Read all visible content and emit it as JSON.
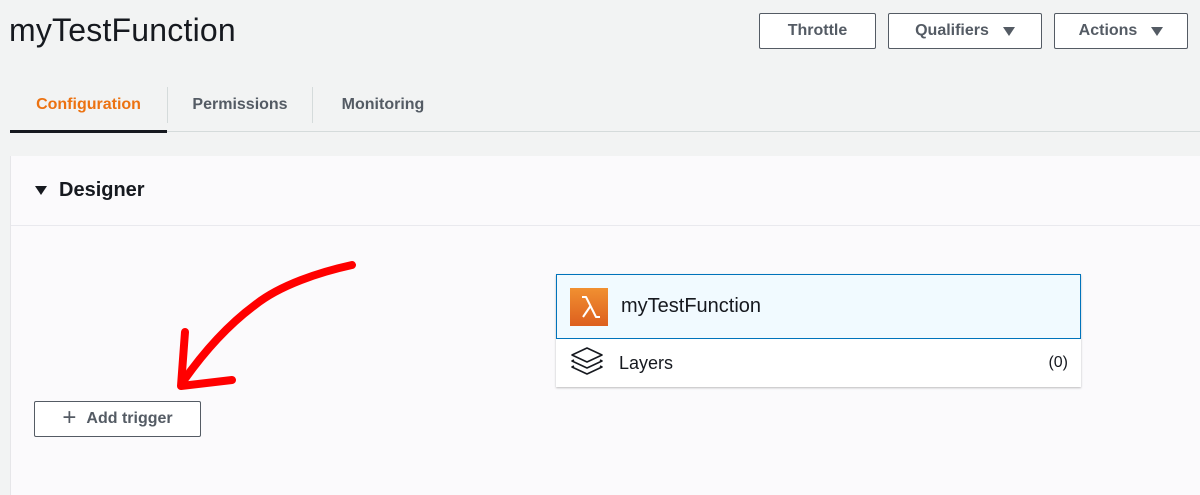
{
  "header": {
    "title": "myTestFunction",
    "buttons": {
      "throttle": "Throttle",
      "qualifiers": "Qualifiers",
      "actions": "Actions"
    }
  },
  "tabs": [
    {
      "label": "Configuration",
      "active": true
    },
    {
      "label": "Permissions",
      "active": false
    },
    {
      "label": "Monitoring",
      "active": false
    }
  ],
  "designer": {
    "title": "Designer",
    "add_trigger_label": "Add trigger",
    "function_name": "myTestFunction",
    "layers_label": "Layers",
    "layers_count": "(0)"
  },
  "colors": {
    "accent_orange": "#ec7211",
    "selected_border": "#0073bb",
    "annotation_red": "#ff0000"
  },
  "icons": {
    "lambda": "lambda-icon",
    "layers": "layers-icon",
    "plus": "plus-icon",
    "caret": "caret-down-icon"
  }
}
